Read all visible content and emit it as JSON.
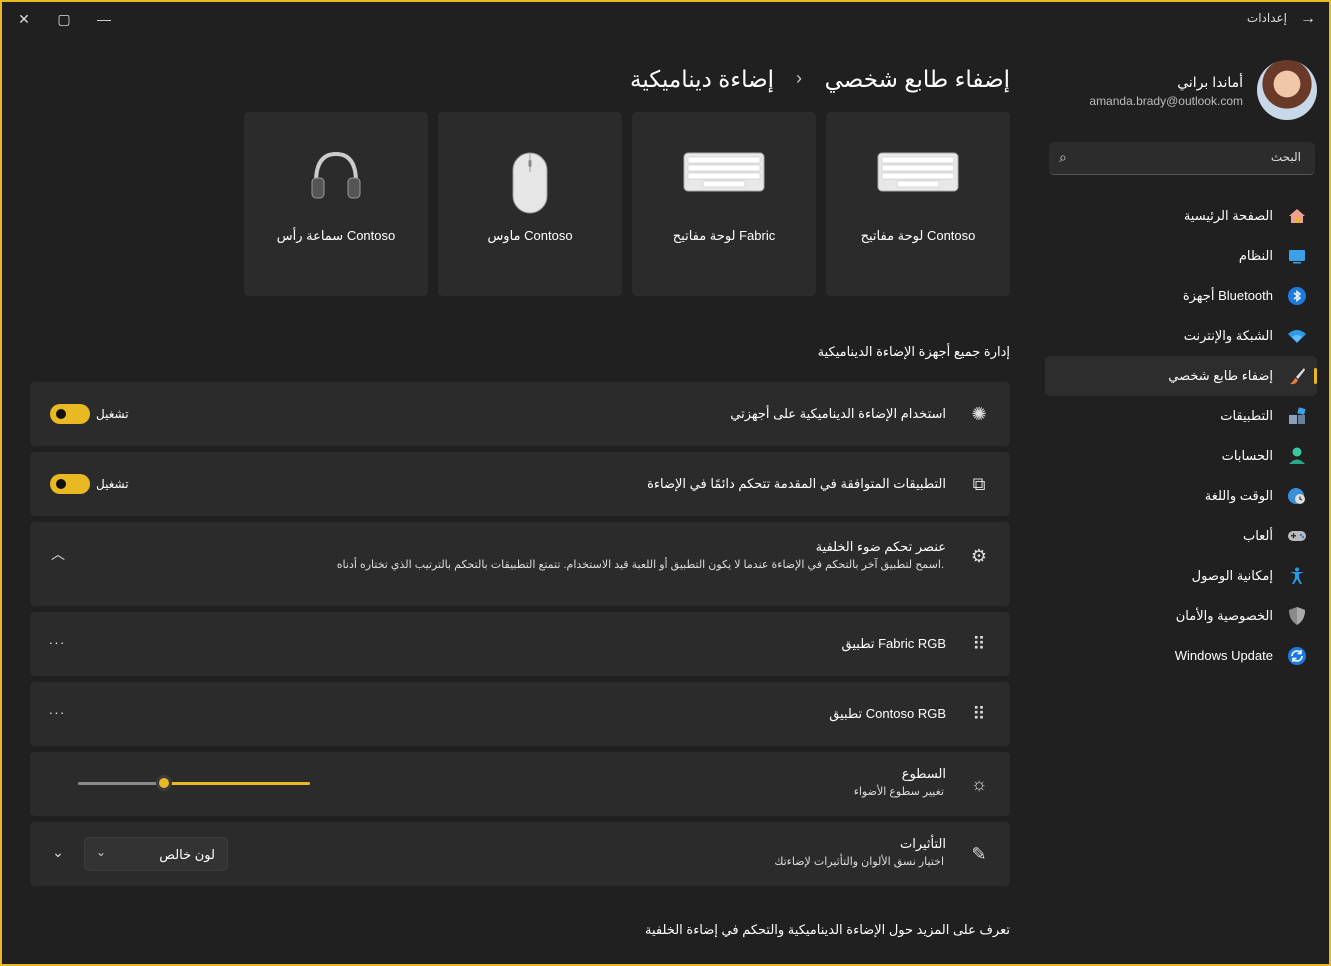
{
  "window": {
    "title": "إعدادات",
    "back_icon": "→",
    "close_icon": "✕",
    "maximize_icon": "▢",
    "minimize_icon": "—"
  },
  "profile": {
    "name": "أماندا براني",
    "email": "amanda.brady@outlook.com"
  },
  "search": {
    "placeholder": "البحث",
    "icon": "⌕"
  },
  "nav": {
    "items": [
      {
        "label": "الصفحة الرئيسية",
        "icon": "home-icon"
      },
      {
        "label": "النظام",
        "icon": "system-icon"
      },
      {
        "label": "أجهزة Bluetooth",
        "icon": "bluetooth-icon"
      },
      {
        "label": "الشبكة والإنترنت",
        "icon": "wifi-icon"
      },
      {
        "label": "إضفاء طابع شخصي",
        "icon": "brush-icon",
        "active": true
      },
      {
        "label": "التطبيقات",
        "icon": "apps-icon"
      },
      {
        "label": "الحسابات",
        "icon": "account-icon"
      },
      {
        "label": "الوقت واللغة",
        "icon": "clock-globe-icon"
      },
      {
        "label": "ألعاب",
        "icon": "gamepad-icon"
      },
      {
        "label": "إمكانية الوصول",
        "icon": "accessibility-icon"
      },
      {
        "label": "الخصوصية والأمان",
        "icon": "shield-icon"
      },
      {
        "label": "Windows Update",
        "icon": "update-icon"
      }
    ]
  },
  "breadcrumb": {
    "parent": "إضفاء طابع شخصي",
    "separator": "›",
    "current": "إضاءة ديناميكية"
  },
  "devices": [
    {
      "label": "لوحة مفاتيح Contoso",
      "icon": "keyboard-icon"
    },
    {
      "label": "لوحة مفاتيح Fabric",
      "icon": "keyboard-icon"
    },
    {
      "label": "ماوس Contoso",
      "icon": "mouse-icon"
    },
    {
      "label": "سماعة رأس Contoso",
      "icon": "headphones-icon"
    }
  ],
  "section_title": "إدارة جميع أجهزة الإضاءة الديناميكية",
  "settings": {
    "use_dynamic": {
      "title": "استخدام الإضاءة الديناميكية على أجهزتي",
      "toggle_label": "تشغيل",
      "on": true,
      "icon": "✺"
    },
    "compatible_apps": {
      "title": "التطبيقات المتوافقة في المقدمة تتحكم دائمًا في الإضاءة",
      "toggle_label": "تشغيل",
      "on": true,
      "icon": "⧉"
    },
    "background_control": {
      "title": "عنصر تحكم ضوء الخلفية",
      "desc": "اسمح لتطبيق آخر بالتحكم في الإضاءة عندما لا يكون التطبيق أو اللعبة قيد الاستخدام. تتمتع التطبيقات بالتحكم بالترتيب الذي تختاره أدناه.",
      "icon": "⚙",
      "chevron": "︿"
    },
    "app_fabric": {
      "title": "تطبيق Fabric RGB",
      "more": "···",
      "drag": "⠿"
    },
    "app_contoso": {
      "title": "تطبيق Contoso RGB",
      "more": "···",
      "drag": "⠿"
    },
    "brightness": {
      "title": "السطوع",
      "desc": "تغيير سطوع الأضواء",
      "icon": "☼",
      "value": 0.63
    },
    "effects": {
      "title": "التأثيرات",
      "desc": "اختيار نسق الألوان والتأثيرات لإضاءتك",
      "icon": "✎",
      "dropdown_value": "لون خالص",
      "dropdown_chev": "⌄",
      "chevron": "⌄"
    }
  },
  "learn_more": "تعرف على المزيد حول الإضاءة الديناميكية والتحكم في إضاءة الخلفية",
  "colors": {
    "accent": "#e8b923",
    "card": "#2b2b2b",
    "background": "#202020"
  }
}
